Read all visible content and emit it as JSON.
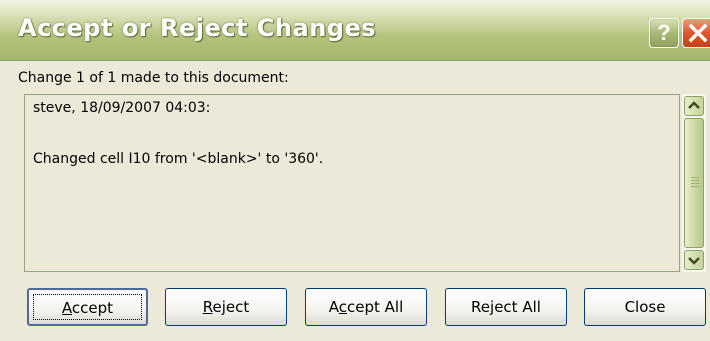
{
  "window": {
    "title": "Accept or Reject Changes",
    "help_glyph": "?"
  },
  "change": {
    "counter_label": "Change 1 of 1 made to this document:",
    "author_line": "steve, 18/09/2007 04:03:",
    "description": "Changed cell I10 from '<blank>' to '360'."
  },
  "buttons": {
    "accept": {
      "pre": "",
      "key": "A",
      "post": "ccept"
    },
    "reject": {
      "pre": "",
      "key": "R",
      "post": "eject"
    },
    "accept_all": {
      "pre": "A",
      "key": "c",
      "post": "cept All"
    },
    "reject_all": {
      "pre": "Re",
      "key": "j",
      "post": "ect All"
    },
    "close": {
      "label": "Close"
    }
  },
  "icons": {
    "help": "question-mark-icon",
    "close": "close-x-icon",
    "scroll_up": "chevron-up-icon",
    "scroll_down": "chevron-down-icon"
  },
  "colors": {
    "titlebar": "#b4c47e",
    "close_button": "#e0572c",
    "dialog_bg": "#ece9d8"
  }
}
